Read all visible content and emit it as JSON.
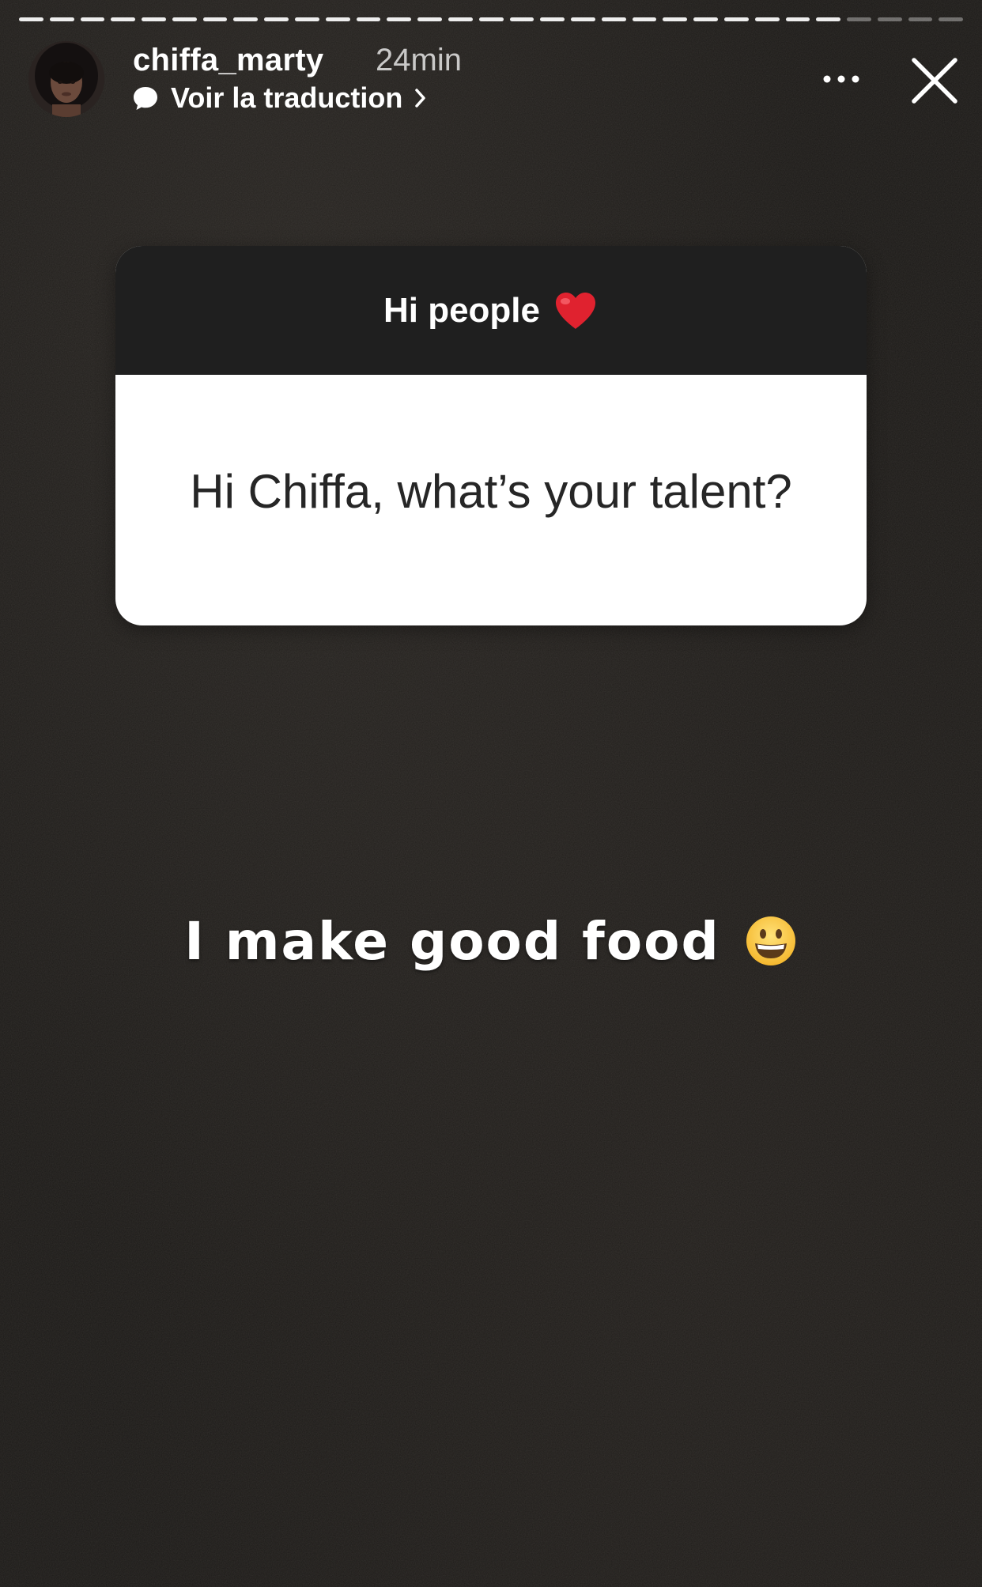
{
  "story": {
    "progress": {
      "segments": 31,
      "viewed": 27
    },
    "header": {
      "username": "chiffa_marty",
      "time": "24min",
      "translation_link": "Voir la traduction",
      "icons": {
        "avatar": "profile-photo",
        "translate": "speech-bubble-icon",
        "chevron": "chevron-right-icon",
        "more": "more-options-icon",
        "close": "close-icon"
      }
    },
    "question_sticker": {
      "header": "Hi people",
      "header_emoji": "red-heart",
      "question": "Hi Chiffa, what’s your talent?"
    },
    "answer": {
      "text": "I make good food",
      "emoji": "grinning-face"
    }
  },
  "colors": {
    "background": "#1b1917",
    "sticker_header": "#1f1f1f",
    "sticker_body": "#ffffff",
    "question_text": "#262626",
    "heart": "#e0222f"
  }
}
